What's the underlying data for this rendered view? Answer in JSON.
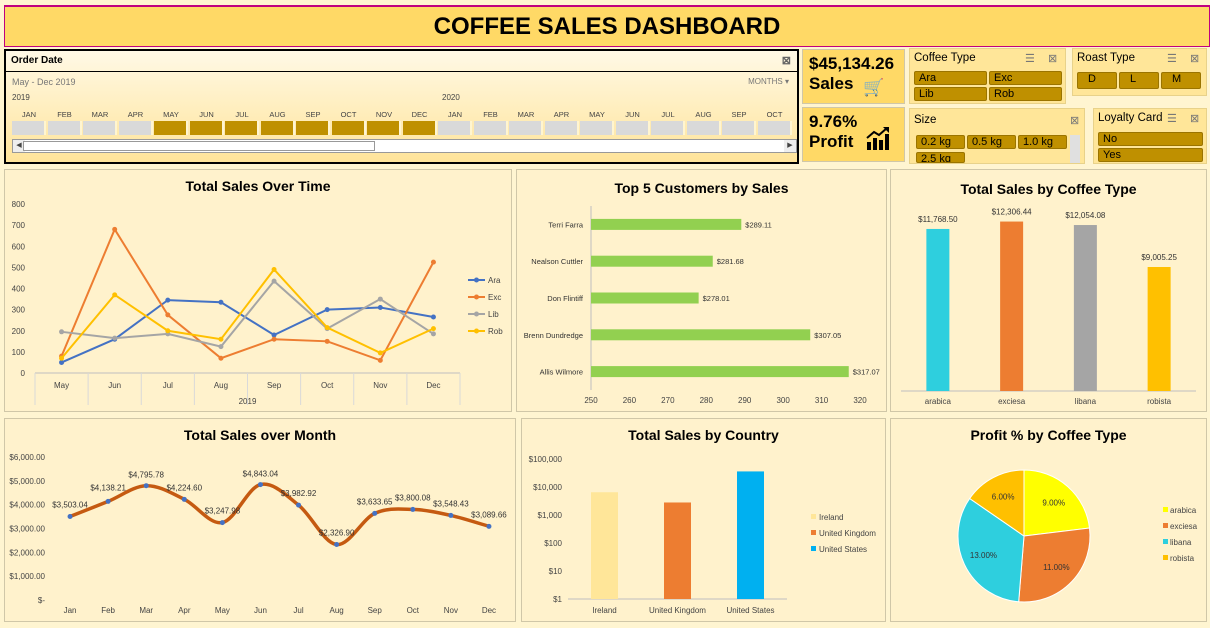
{
  "title": "COFFEE SALES DASHBOARD",
  "timeline": {
    "header": "Order Date",
    "range": "May - Dec 2019",
    "granularity": "MONTHS ▾",
    "years": [
      "2019",
      "2020"
    ],
    "months": [
      "JAN",
      "FEB",
      "MAR",
      "APR",
      "MAY",
      "JUN",
      "JUL",
      "AUG",
      "SEP",
      "OCT",
      "NOV",
      "DEC",
      "JAN",
      "FEB",
      "MAR",
      "APR",
      "MAY",
      "JUN",
      "JUL",
      "AUG",
      "SEP",
      "OCT"
    ],
    "selected": [
      false,
      false,
      false,
      false,
      true,
      true,
      true,
      true,
      true,
      true,
      true,
      true,
      false,
      false,
      false,
      false,
      false,
      false,
      false,
      false,
      false,
      false
    ]
  },
  "kpi": {
    "sales_value": "$45,134.26",
    "sales_label": "Sales",
    "profit_value": "9.76%",
    "profit_label": "Profit"
  },
  "slicers": {
    "coffee_type": {
      "title": "Coffee Type",
      "items": [
        "Ara",
        "Exc",
        "Lib",
        "Rob"
      ]
    },
    "roast_type": {
      "title": "Roast Type",
      "items": [
        "D",
        "L",
        "M"
      ]
    },
    "size": {
      "title": "Size",
      "items": [
        "0.2 kg",
        "0.5 kg",
        "1.0 kg",
        "2.5 kg"
      ]
    },
    "loyalty": {
      "title": "Loyalty Card",
      "items": [
        "No",
        "Yes"
      ]
    }
  },
  "colors": {
    "ara": "#4472c4",
    "exc": "#ed7d31",
    "lib": "#a5a5a5",
    "rob": "#ffc000",
    "bar_green": "#92d050",
    "arabica": "#2ecfde",
    "excelsa": "#ed7d31",
    "liberica": "#a5a5a5",
    "robusta": "#ffc000",
    "ireland": "#ffe699",
    "uk": "#ed7d31",
    "us": "#00b0f0",
    "month_line": "#c55a11"
  },
  "chart_data": [
    {
      "type": "line",
      "title": "Total Sales Over Time",
      "categories": [
        "May",
        "Jun",
        "Jul",
        "Aug",
        "Sep",
        "Oct",
        "Nov",
        "Dec"
      ],
      "xgroup": "2019",
      "ylim": [
        0,
        800
      ],
      "yticks": [
        "0",
        "100",
        "200",
        "300",
        "400",
        "500",
        "600",
        "700",
        "800"
      ],
      "legend": "right",
      "series": [
        {
          "name": "Ara",
          "values": [
            50,
            160,
            345,
            335,
            180,
            300,
            310,
            265
          ]
        },
        {
          "name": "Exc",
          "values": [
            80,
            680,
            275,
            70,
            160,
            150,
            60,
            525
          ]
        },
        {
          "name": "Lib",
          "values": [
            195,
            165,
            185,
            125,
            435,
            210,
            350,
            185
          ]
        },
        {
          "name": "Rob",
          "values": [
            70,
            370,
            200,
            160,
            490,
            215,
            95,
            210
          ]
        }
      ]
    },
    {
      "type": "bar",
      "orientation": "horizontal",
      "title": "Top 5 Customers by Sales",
      "categories": [
        "Terri Farra",
        "Nealson Cuttler",
        "Don Flintiff",
        "Brenn Dundredge",
        "Allis Wilmore"
      ],
      "values": [
        289.11,
        281.68,
        278.01,
        307.05,
        317.07
      ],
      "labels": [
        "$289.11",
        "$281.68",
        "$278.01",
        "$307.05",
        "$317.07"
      ],
      "xlim": [
        250,
        320
      ],
      "xticks": [
        "250",
        "260",
        "270",
        "280",
        "290",
        "300",
        "310",
        "320"
      ]
    },
    {
      "type": "bar",
      "title": "Total Sales by Coffee Type",
      "categories": [
        "arabica",
        "exciesa",
        "libana",
        "robista"
      ],
      "values": [
        11768.5,
        12306.44,
        12054.08,
        9005.25
      ],
      "labels": [
        "$11,768.50",
        "$12,306.44",
        "$12,054.08",
        "$9,005.25"
      ],
      "ylim": [
        0,
        13000
      ]
    },
    {
      "type": "line",
      "title": "Total Sales over Month",
      "categories": [
        "Jan",
        "Feb",
        "Mar",
        "Apr",
        "May",
        "Jun",
        "Jul",
        "Aug",
        "Sep",
        "Oct",
        "Nov",
        "Dec"
      ],
      "values": [
        3503.04,
        4138.21,
        4795.78,
        4224.6,
        3247.98,
        4843.04,
        3982.92,
        2326.9,
        3633.65,
        3800.08,
        3548.43,
        3089.66
      ],
      "labels": [
        "$3,503.04",
        "$4,138.21",
        "$4,795.78",
        "$4,224.60",
        "$3,247.98",
        "$4,843.04",
        "$3,982.92",
        "$2,326.90",
        "$3,633.65",
        "$3,800.08",
        "$3,548.43",
        "$3,089.66"
      ],
      "ylim": [
        0,
        6000
      ],
      "yticks": [
        "$-",
        "$1,000.00",
        "$2,000.00",
        "$3,000.00",
        "$4,000.00",
        "$5,000.00",
        "$6,000.00"
      ]
    },
    {
      "type": "bar",
      "title": "Total Sales by Country",
      "scale": "log",
      "categories": [
        "Ireland",
        "United Kingdom",
        "United States"
      ],
      "values": [
        6500,
        2800,
        36000
      ],
      "ylim": [
        1,
        100000
      ],
      "yticks": [
        "$1",
        "$10",
        "$100",
        "$1,000",
        "$10,000",
        "$100,000"
      ],
      "legend": "right"
    },
    {
      "type": "pie",
      "title": "Profit % by Coffee Type",
      "categories": [
        "arabica",
        "exciesa",
        "libana",
        "robista"
      ],
      "values": [
        9.0,
        11.0,
        13.0,
        6.0
      ],
      "labels": [
        "9.00%",
        "11.00%",
        "13.00%",
        "6.00%"
      ],
      "legend": "right"
    }
  ]
}
